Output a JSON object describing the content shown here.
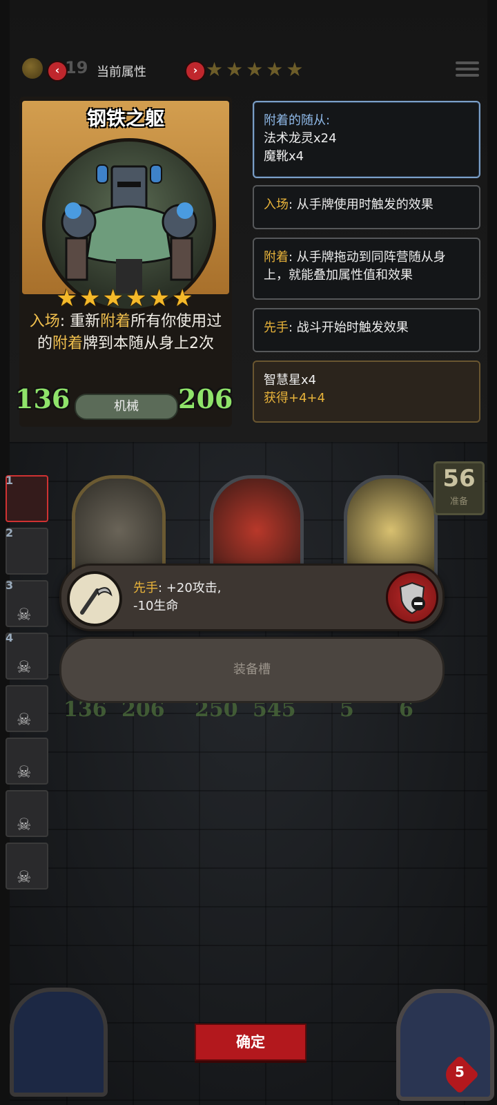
{
  "top_bar": {
    "coin_count": "19",
    "prev_symbol": "‹",
    "next_symbol": "›",
    "attr_label": "当前属性",
    "stars": "★★★★★"
  },
  "card": {
    "name": "钢铁之躯",
    "stars": "★★★★★★",
    "text_part1": "入场",
    "text_part2": ": 重新",
    "text_part3": "附着",
    "text_part4": "所有你使用过的",
    "text_part5": "附着",
    "text_part6": "牌到本随从身上2次",
    "attack": "136",
    "health": "206",
    "tribe": "机械"
  },
  "info": {
    "attached_title": "附着的随从:",
    "attached_line1": "法术龙灵x24",
    "attached_line2": "魔靴x4",
    "battlecry_key": "入场",
    "battlecry_desc": ": 从手牌使用时触发的效果",
    "attach_key": "附着",
    "attach_desc": ": 从手牌拖动到同阵营随从身上，就能叠加属性值和效果",
    "first_key": "先手",
    "first_desc": ": 战斗开始时触发效果",
    "bonus_line1": "智慧星x4",
    "bonus_line2": "获得+4+4"
  },
  "roster": [
    {
      "num": "1"
    },
    {
      "num": "2"
    },
    {
      "num": "3"
    },
    {
      "num": "4"
    }
  ],
  "counter": {
    "value": "56",
    "sub": "准备"
  },
  "equip": {
    "key": "先手",
    "line1": ": +20攻击,",
    "line2": "-10生命",
    "empty_label": "装备槽"
  },
  "board_stats": {
    "a1": "136",
    "h1": "206",
    "a2": "250",
    "h2": "545",
    "a3": "5",
    "h3": "6"
  },
  "confirm_label": "确定",
  "lives": "5",
  "colors": {
    "accent_gold": "#e8b33a",
    "stat_green": "#8fe36a",
    "button_red": "#b3181d",
    "panel_blue": "#7b9fc7"
  }
}
